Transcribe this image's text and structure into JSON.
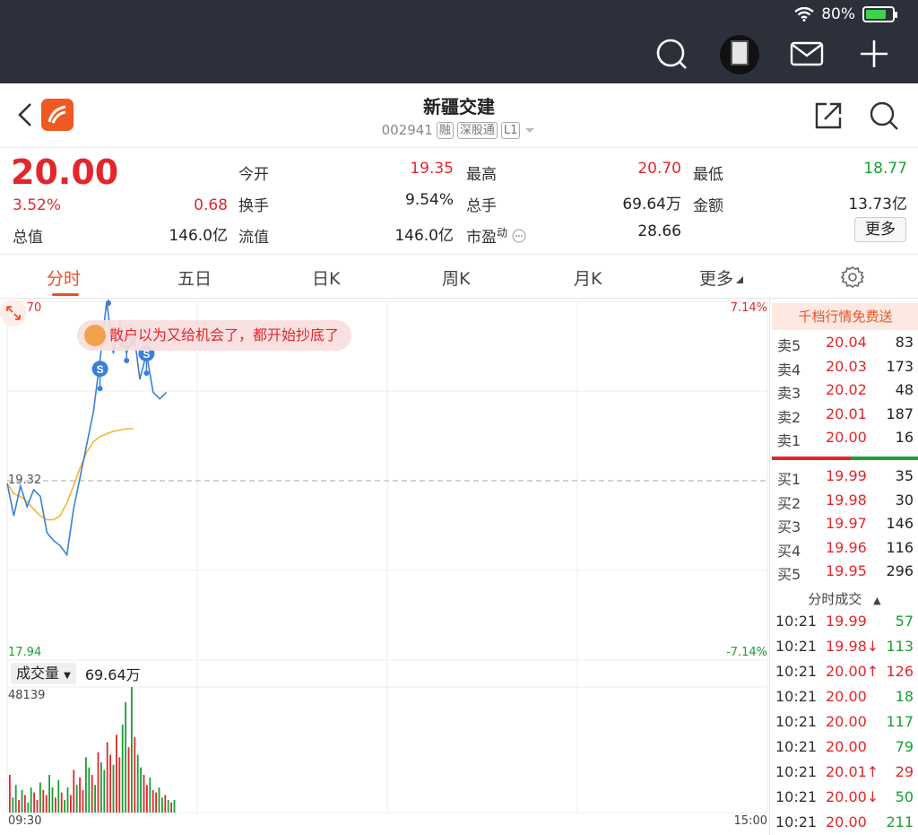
{
  "status_bar": {
    "battery": "80%",
    "battery_level": 0.8
  },
  "header": {
    "title": "新疆交建",
    "code": "002941",
    "tags": [
      "融",
      "深股通",
      "L1"
    ]
  },
  "quote": {
    "price": "20.00",
    "change_pct": "3.52%",
    "change": "0.68",
    "fields": [
      {
        "label": "今开",
        "value": "19.35",
        "color": "red"
      },
      {
        "label": "最高",
        "value": "20.70",
        "color": "red"
      },
      {
        "label": "最低",
        "value": "18.77",
        "color": "green"
      },
      {
        "label": "换手",
        "value": "9.54%",
        "color": "dark"
      },
      {
        "label": "总手",
        "value": "69.64万",
        "color": "dark"
      },
      {
        "label": "金额",
        "value": "13.73亿",
        "color": "dark"
      },
      {
        "label": "总值",
        "value": "146.0亿",
        "color": "dark"
      },
      {
        "label": "流值",
        "value": "146.0亿",
        "color": "dark"
      },
      {
        "label": "市盈",
        "value": "28.66",
        "color": "dark"
      }
    ],
    "pe_sup": "动",
    "more_label": "更多"
  },
  "tabs": {
    "items": [
      "分时",
      "五日",
      "日K",
      "周K",
      "月K",
      "更多"
    ],
    "active": 0
  },
  "chart": {
    "y_top": "20.70",
    "y_mid": "19.32",
    "y_bottom": "17.94",
    "pct_top": "7.14%",
    "pct_bottom": "-7.14%",
    "bubble_text": "散户以为又给机会了，都开始抄底了",
    "signal_label": "S",
    "volume_label": "成交量",
    "volume_total": "69.64万",
    "volume_max": "48139",
    "time_start": "09:30",
    "time_end": "15:00",
    "colors": {
      "price": "#3b7fd8",
      "avg": "#f5b731",
      "up": "#e4262c",
      "down": "#1aa034"
    }
  },
  "chart_data": {
    "type": "line",
    "title": "",
    "ylim": [
      17.94,
      20.7
    ],
    "prev_close": 19.32,
    "price_series": [
      19.3,
      19.05,
      19.28,
      19.12,
      19.25,
      19.2,
      18.92,
      18.86,
      18.82,
      18.75,
      19.1,
      19.35,
      19.6,
      19.85,
      20.25,
      20.7,
      20.3,
      20.55,
      20.3,
      20.5,
      20.1,
      20.3,
      20.0,
      19.95,
      20.0
    ],
    "avg_series": [
      19.3,
      19.22,
      19.2,
      19.16,
      19.1,
      19.05,
      19.02,
      19.02,
      19.05,
      19.15,
      19.28,
      19.42,
      19.54,
      19.62,
      19.66,
      19.68,
      19.7,
      19.71,
      19.72,
      19.72
    ]
  },
  "order_book": {
    "banner": "千档行情免费送",
    "asks": [
      {
        "label": "卖5",
        "price": "20.04",
        "vol": "83"
      },
      {
        "label": "卖4",
        "price": "20.03",
        "vol": "173"
      },
      {
        "label": "卖3",
        "price": "20.02",
        "vol": "48"
      },
      {
        "label": "卖2",
        "price": "20.01",
        "vol": "187"
      },
      {
        "label": "卖1",
        "price": "20.00",
        "vol": "16"
      }
    ],
    "bids": [
      {
        "label": "买1",
        "price": "19.99",
        "vol": "35"
      },
      {
        "label": "买2",
        "price": "19.98",
        "vol": "30"
      },
      {
        "label": "买3",
        "price": "19.97",
        "vol": "146"
      },
      {
        "label": "买4",
        "price": "19.96",
        "vol": "116"
      },
      {
        "label": "买5",
        "price": "19.95",
        "vol": "296"
      }
    ],
    "ticks_title": "分时成交",
    "ticks": [
      {
        "time": "10:21",
        "price": "19.99",
        "vol": "57",
        "side": "down"
      },
      {
        "time": "10:21",
        "price": "19.98↓",
        "vol": "113",
        "side": "down"
      },
      {
        "time": "10:21",
        "price": "20.00↑",
        "vol": "126",
        "side": "up"
      },
      {
        "time": "10:21",
        "price": "20.00",
        "vol": "18",
        "side": "down"
      },
      {
        "time": "10:21",
        "price": "20.00",
        "vol": "117",
        "side": "down"
      },
      {
        "time": "10:21",
        "price": "20.00",
        "vol": "79",
        "side": "down"
      },
      {
        "time": "10:21",
        "price": "20.01↑",
        "vol": "29",
        "side": "up"
      },
      {
        "time": "10:21",
        "price": "20.00↓",
        "vol": "50",
        "side": "down"
      },
      {
        "time": "10:21",
        "price": "20.00",
        "vol": "211",
        "side": "down"
      }
    ]
  }
}
